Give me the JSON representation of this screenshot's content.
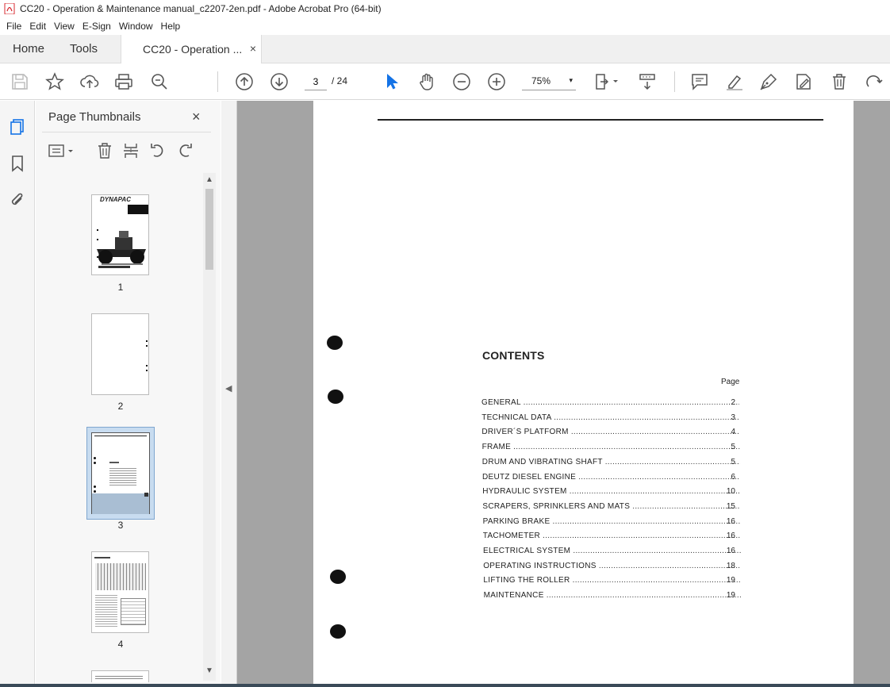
{
  "window": {
    "title": "CC20 - Operation & Maintenance manual_c2207-2en.pdf - Adobe Acrobat Pro (64-bit)"
  },
  "menu": [
    "File",
    "Edit",
    "View",
    "E-Sign",
    "Window",
    "Help"
  ],
  "tabs": {
    "home": "Home",
    "tools": "Tools",
    "document": "CC20 - Operation ...",
    "close": "×"
  },
  "toolbar": {
    "page_current": "3",
    "page_total": "/ 24",
    "zoom": "75%",
    "zoom_caret": "▾"
  },
  "panel": {
    "title": "Page Thumbnails",
    "close": "×",
    "thumbnails": [
      {
        "number": "1",
        "brand": "DYNAPAC"
      },
      {
        "number": "2"
      },
      {
        "number": "3",
        "selected": true
      },
      {
        "number": "4"
      }
    ]
  },
  "document": {
    "contents_title": "CONTENTS",
    "page_header": "Page",
    "toc": [
      {
        "label": "GENERAL",
        "page": "2"
      },
      {
        "label": "TECHNICAL DATA",
        "page": "3"
      },
      {
        "label": "DRIVER´S PLATFORM",
        "page": "4"
      },
      {
        "label": "FRAME",
        "page": "5"
      },
      {
        "label": "DRUM AND VIBRATING SHAFT",
        "page": "5"
      },
      {
        "label": "DEUTZ DIESEL ENGINE",
        "page": "6"
      },
      {
        "label": "HYDRAULIC SYSTEM",
        "page": "10"
      },
      {
        "label": "SCRAPERS, SPRINKLERS AND MATS",
        "page": "15"
      },
      {
        "label": "PARKING BRAKE",
        "page": "16"
      },
      {
        "label": "TACHOMETER",
        "page": "16"
      },
      {
        "label": "ELECTRICAL SYSTEM",
        "page": "16"
      },
      {
        "label": "OPERATING INSTRUCTIONS",
        "page": "18"
      },
      {
        "label": "LIFTING THE ROLLER",
        "page": "19"
      },
      {
        "label": "MAINTENANCE",
        "page": "19"
      }
    ]
  },
  "icons": {
    "toolbar": [
      "save-icon",
      "star-icon",
      "upload-icon",
      "print-icon",
      "zoom-search-icon",
      "page-up-icon",
      "page-down-icon",
      "select-arrow-icon",
      "hand-icon",
      "zoom-out-icon",
      "zoom-in-icon",
      "fit-page-icon",
      "scroll-mode-icon",
      "comment-icon",
      "highlight-icon",
      "sign-icon",
      "fill-sign-icon",
      "delete-icon",
      "rotate-icon"
    ],
    "accent": "#1473e6"
  }
}
